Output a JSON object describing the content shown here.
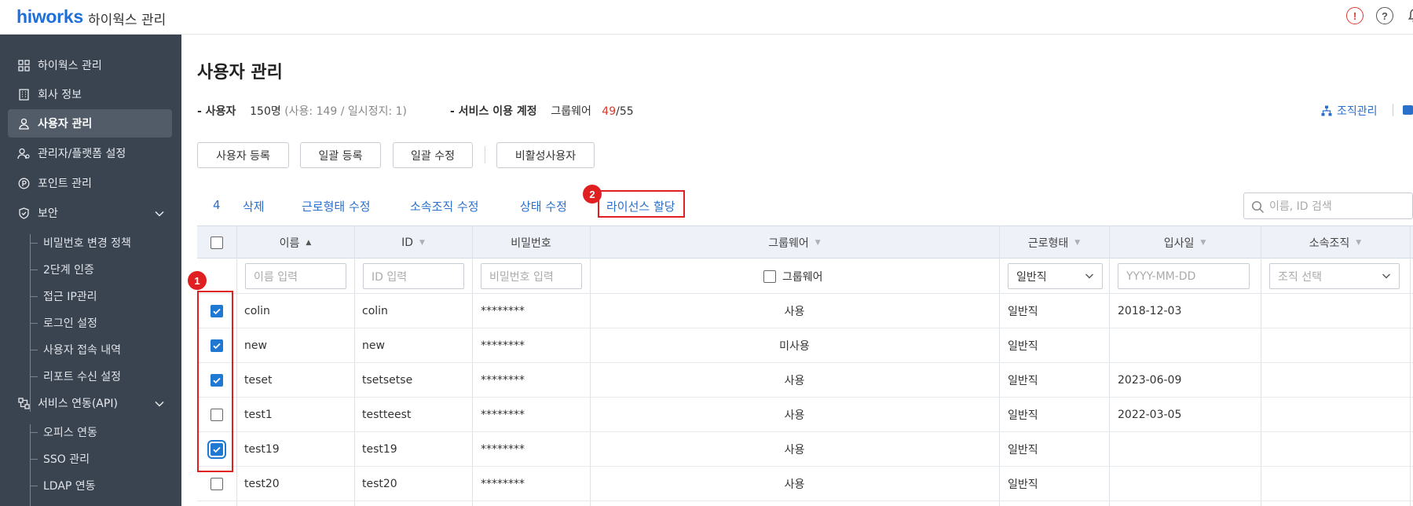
{
  "header": {
    "logo": "hiworks",
    "title": "하이웍스 관리",
    "alert_icon_glyph": "!",
    "help_icon_glyph": "?"
  },
  "sidebar": {
    "items": [
      {
        "label": "하이웍스 관리",
        "icon": "grid-icon"
      },
      {
        "label": "회사 정보",
        "icon": "building-icon"
      },
      {
        "label": "사용자 관리",
        "icon": "user-icon",
        "active": true
      },
      {
        "label": "관리자/플랫폼 설정",
        "icon": "admin-users-icon"
      },
      {
        "label": "포인트 관리",
        "icon": "point-icon"
      },
      {
        "label": "보안",
        "icon": "shield-icon",
        "expanded": true
      },
      {
        "label": "서비스 연동(API)",
        "icon": "api-icon",
        "expanded": true
      }
    ],
    "security_sub": [
      "비밀번호 변경 정책",
      "2단계 인증",
      "접근 IP관리",
      "로그인 설정",
      "사용자 접속 내역",
      "리포트 수신 설정"
    ],
    "api_sub": [
      "오피스 연동",
      "SSO 관리",
      "LDAP 연동"
    ]
  },
  "main": {
    "title": "사용자 관리",
    "summary": {
      "users_label": "- 사용자",
      "users_count": "150명",
      "users_detail": "(사용: 149 / 일시정지: 1)",
      "service_label": "- 서비스 이용 계정",
      "groupware_label": "그룹웨어",
      "used": "49",
      "total": "/55"
    },
    "org_link": "조직관리",
    "buttons": [
      "사용자 등록",
      "일괄 등록",
      "일괄 수정",
      "비활성사용자"
    ],
    "actions": {
      "count": "4",
      "delete": "삭제",
      "work_type": "근로형태 수정",
      "org": "소속조직 수정",
      "status": "상태 수정",
      "license": "라이선스 할당"
    },
    "markers": [
      "1",
      "2"
    ],
    "search_placeholder": "이름, ID 검색"
  },
  "table": {
    "headers": {
      "name": "이름",
      "id": "ID",
      "password": "비밀번호",
      "groupware": "그룹웨어",
      "work_type": "근로형태",
      "join_date": "입사일",
      "org": "소속조직"
    },
    "filters": {
      "name_placeholder": "이름 입력",
      "id_placeholder": "ID 입력",
      "password_placeholder": "비밀번호 입력",
      "groupware_label": "그룹웨어",
      "work_type_value": "일반직",
      "date_placeholder": "YYYY-MM-DD",
      "org_placeholder": "조직 선택"
    },
    "rows": [
      {
        "checked": true,
        "name": "colin",
        "id": "colin",
        "password": "********",
        "groupware": "사용",
        "work_type": "일반직",
        "join_date": "2018-12-03",
        "org": ""
      },
      {
        "checked": true,
        "name": "new",
        "id": "new",
        "password": "********",
        "groupware": "미사용",
        "work_type": "일반직",
        "join_date": "",
        "org": ""
      },
      {
        "checked": true,
        "name": "teset",
        "id": "tsetsetse",
        "password": "********",
        "groupware": "사용",
        "work_type": "일반직",
        "join_date": "2023-06-09",
        "org": ""
      },
      {
        "checked": false,
        "name": "test1",
        "id": "testteest",
        "password": "********",
        "groupware": "사용",
        "work_type": "일반직",
        "join_date": "2022-03-05",
        "org": ""
      },
      {
        "checked": true,
        "name": "test19",
        "id": "test19",
        "password": "********",
        "groupware": "사용",
        "work_type": "일반직",
        "join_date": "",
        "org": ""
      },
      {
        "checked": false,
        "name": "test20",
        "id": "test20",
        "password": "********",
        "groupware": "사용",
        "work_type": "일반직",
        "join_date": "",
        "org": ""
      }
    ]
  }
}
